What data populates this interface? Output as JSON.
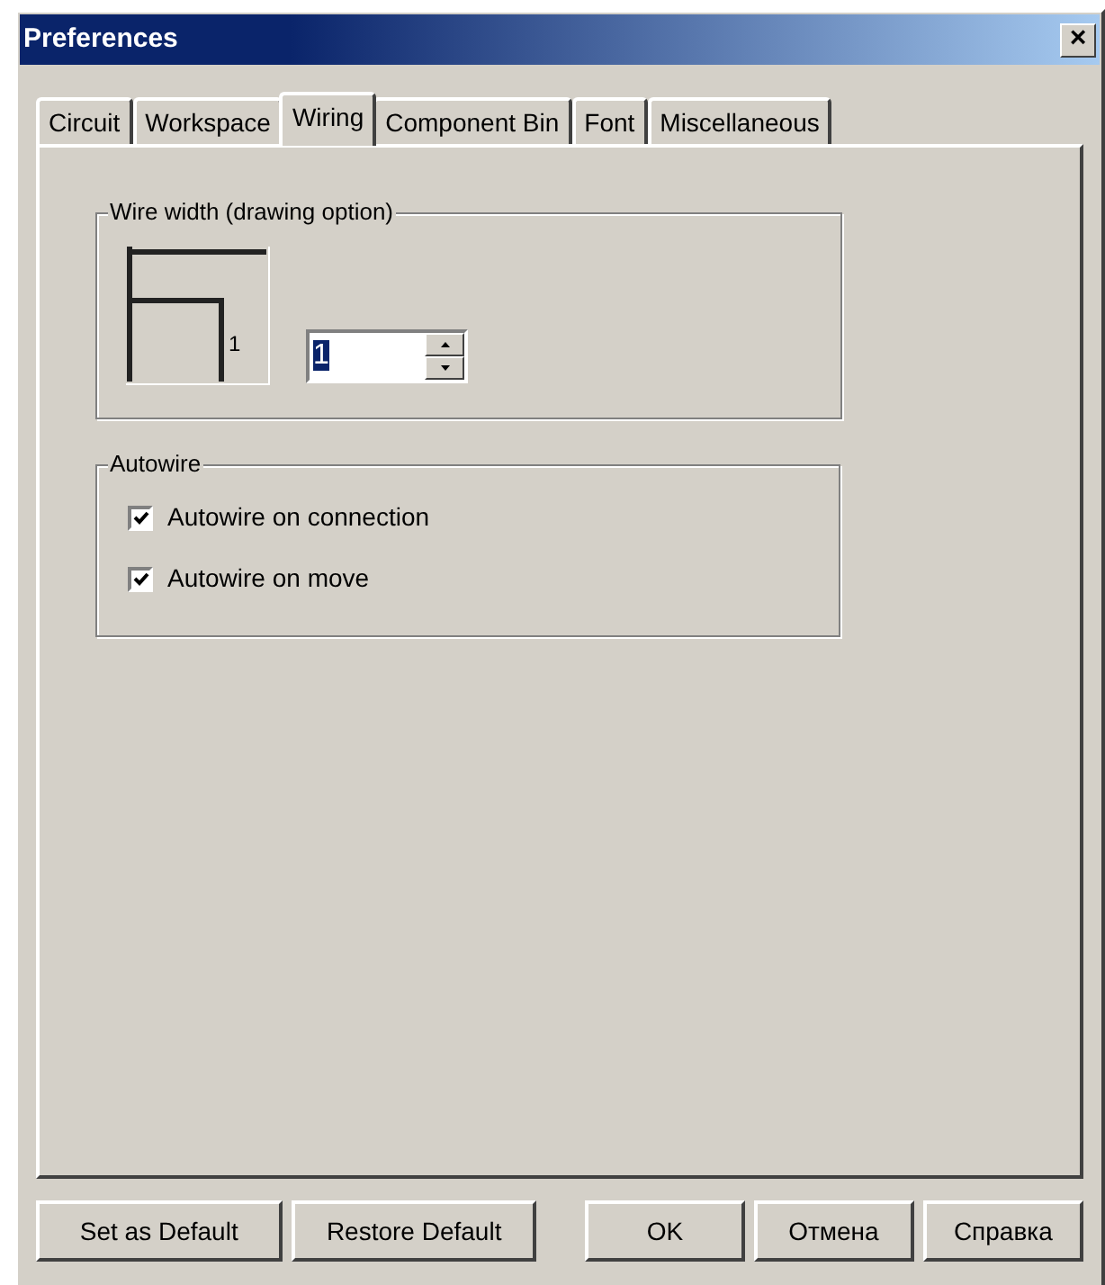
{
  "window": {
    "title": "Preferences",
    "close": "×"
  },
  "tabs": [
    {
      "label": "Circuit",
      "selected": false
    },
    {
      "label": "Workspace",
      "selected": false
    },
    {
      "label": "Wiring",
      "selected": true
    },
    {
      "label": "Component Bin",
      "selected": false
    },
    {
      "label": "Font",
      "selected": false
    },
    {
      "label": "Miscellaneous",
      "selected": false
    }
  ],
  "wire_width": {
    "legend": "Wire width (drawing option)",
    "preview_label": "1",
    "value": "1"
  },
  "autowire": {
    "legend": "Autowire",
    "options": [
      {
        "label": "Autowire on connection",
        "checked": true
      },
      {
        "label": "Autowire on move",
        "checked": true
      }
    ]
  },
  "buttons": [
    {
      "label": "Set as Default"
    },
    {
      "label": "Restore Default"
    },
    {
      "label": "OK"
    },
    {
      "label": "Отмена"
    },
    {
      "label": "Справка"
    }
  ]
}
